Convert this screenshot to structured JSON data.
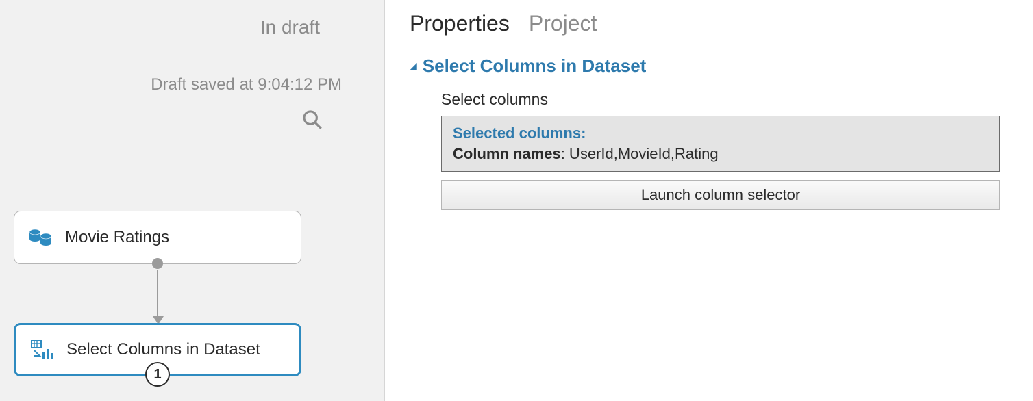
{
  "canvas": {
    "status_draft": "In draft",
    "status_saved": "Draft saved at 9:04:12 PM",
    "nodes": {
      "dataset": {
        "label": "Movie Ratings"
      },
      "select_cols": {
        "label": "Select Columns in Dataset",
        "port_badge": "1"
      }
    }
  },
  "tabs": {
    "properties": "Properties",
    "project": "Project"
  },
  "props": {
    "section_title": "Select Columns in Dataset",
    "field_label": "Select columns",
    "selected_header": "Selected columns:",
    "column_names_label": "Column names",
    "column_names_value": ": UserId,MovieId,Rating",
    "launch_button": "Launch column selector"
  }
}
